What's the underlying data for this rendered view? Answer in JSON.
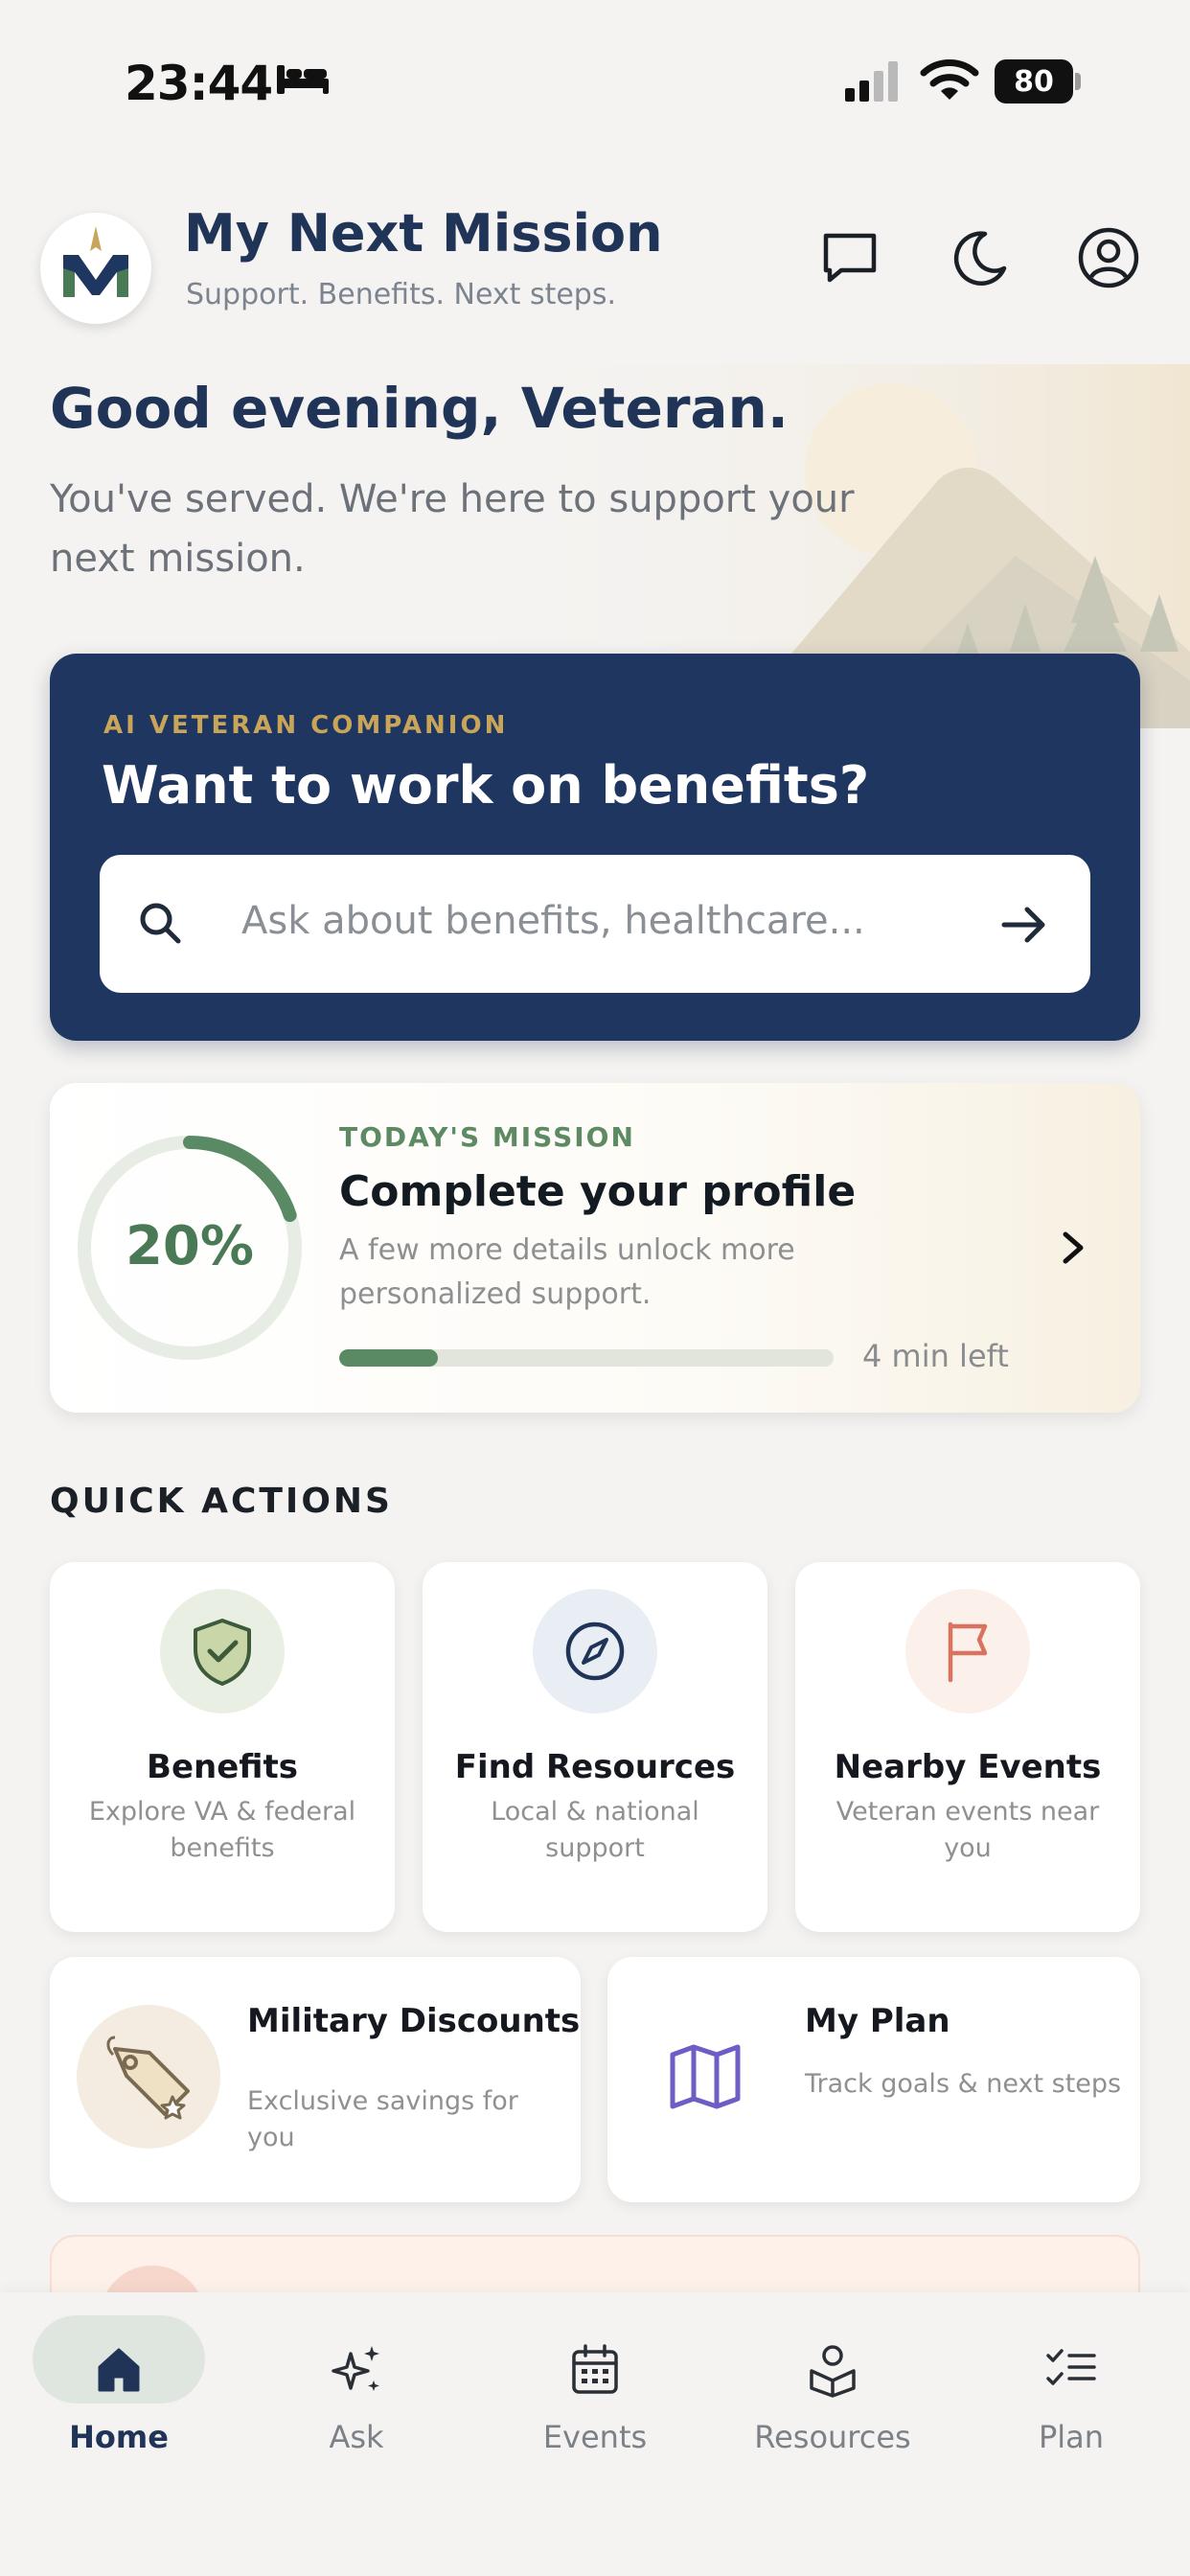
{
  "status_bar": {
    "time": "23:44",
    "battery": "80"
  },
  "header": {
    "title": "My Next Mission",
    "subtitle": "Support. Benefits. Next steps."
  },
  "hero": {
    "greeting": "Good evening, Veteran.",
    "subtext": "You've served. We're here to support your next mission."
  },
  "ai_card": {
    "eyebrow": "AI VETERAN COMPANION",
    "title": "Want to work on benefits?",
    "search_placeholder": "Ask about benefits, healthcare..."
  },
  "mission": {
    "eyebrow": "TODAY'S MISSION",
    "title": "Complete your profile",
    "description": "A few more details unlock more personalized support.",
    "percent_label": "20%",
    "progress": 0.2,
    "time_left": "4 min left"
  },
  "quick_actions": {
    "heading": "QUICK ACTIONS",
    "tiles": [
      {
        "title": "Benefits",
        "subtitle": "Explore VA & federal benefits",
        "icon": "shield-check-icon"
      },
      {
        "title": "Find Resources",
        "subtitle": "Local & national support",
        "icon": "compass-icon"
      },
      {
        "title": "Nearby Events",
        "subtitle": "Veteran events near you",
        "icon": "flag-icon"
      }
    ],
    "wide_tiles": [
      {
        "title": "Military Discounts",
        "subtitle": "Exclusive savings for you",
        "icon": "tag-icon"
      },
      {
        "title": "My Plan",
        "subtitle": "Track goals & next steps",
        "icon": "map-icon"
      }
    ]
  },
  "nav": {
    "items": [
      {
        "label": "Home",
        "icon": "home-icon",
        "active": true
      },
      {
        "label": "Ask",
        "icon": "sparkle-icon"
      },
      {
        "label": "Events",
        "icon": "calendar-icon"
      },
      {
        "label": "Resources",
        "icon": "resources-icon"
      },
      {
        "label": "Plan",
        "icon": "checklist-icon"
      }
    ]
  },
  "colors": {
    "navy": "#1f3660",
    "green": "#5a8a63",
    "gold": "#c9a55a",
    "background": "#f4f3f1"
  }
}
